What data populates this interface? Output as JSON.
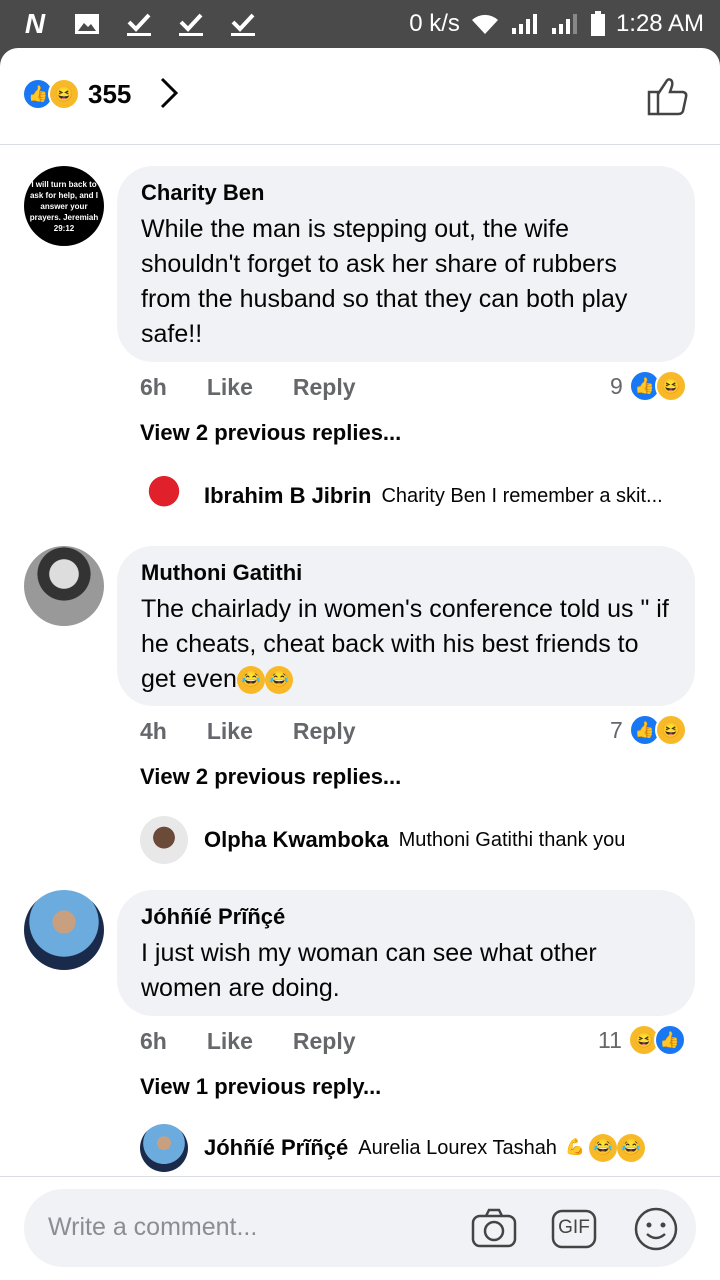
{
  "status_bar": {
    "left_icons": [
      "n-app-icon",
      "image-icon",
      "check-icon",
      "check-icon",
      "check-icon"
    ],
    "speed": "0 k/s",
    "time": "1:28 AM"
  },
  "header": {
    "reaction_count": "355"
  },
  "comments": [
    {
      "author": "Charity Ben",
      "text": "While the man is stepping out, the wife shouldn't forget to ask her share of rubbers from the husband so that they can both play safe!!",
      "time": "6h",
      "like_label": "Like",
      "reply_label": "Reply",
      "reaction_count": "9",
      "view_previous": "View 2 previous replies...",
      "avatar_text": "I will turn back to ask for help, and I answer your prayers. Jeremiah 29:12",
      "reply_author": "Ibrahim B Jibrin",
      "reply_text": "Charity Ben I remember a skit..."
    },
    {
      "author": "Muthoni Gatithi",
      "text": "The chairlady in women's conference told us \" if he cheats, cheat back with his best friends to get even",
      "time": "4h",
      "like_label": "Like",
      "reply_label": "Reply",
      "reaction_count": "7",
      "view_previous": "View 2 previous replies...",
      "reply_author": "Olpha Kwamboka",
      "reply_text": "Muthoni Gatithi thank you"
    },
    {
      "author": "Jóhñíé Prĩñçé",
      "text": "I just wish my woman can see what other women are doing.",
      "time": "6h",
      "like_label": "Like",
      "reply_label": "Reply",
      "reaction_count": "11",
      "view_previous": "View 1 previous reply...",
      "reply_author": "Jóhñíé Prĩñçé",
      "reply_text": "Aurelia Lourex Tashah"
    }
  ],
  "composer": {
    "placeholder": "Write a comment...",
    "gif_label": "GIF"
  },
  "colors": {
    "like_blue": "#1877f2",
    "haha_yellow": "#f7b928",
    "bubble_bg": "#f0f2f5",
    "meta_gray": "#65676b"
  }
}
